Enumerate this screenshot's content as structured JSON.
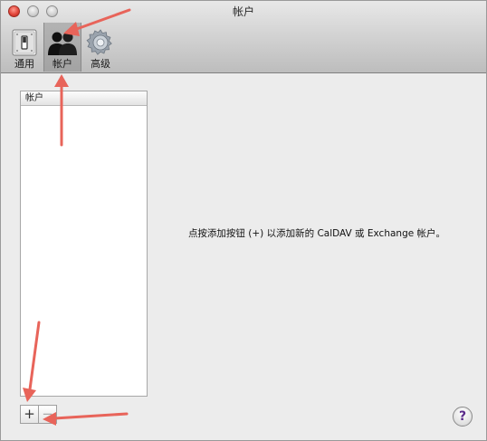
{
  "window": {
    "title": "帐户"
  },
  "toolbar": {
    "items": [
      {
        "label": "通用",
        "icon": "general-switch-icon",
        "selected": false
      },
      {
        "label": "帐户",
        "icon": "accounts-people-icon",
        "selected": true
      },
      {
        "label": "高级",
        "icon": "gear-icon",
        "selected": false
      }
    ]
  },
  "accounts_list": {
    "header": "帐户",
    "items": []
  },
  "controls": {
    "add_label": "+",
    "remove_label": "−"
  },
  "main": {
    "message": "点按添加按钮 (+) 以添加新的 CalDAV 或 Exchange 帐户。"
  },
  "help": {
    "label": "?"
  },
  "colors": {
    "annotation_arrow": "#e8645a",
    "window_background": "#ececec",
    "selected_toolbar_item": "#a9a9a9"
  }
}
